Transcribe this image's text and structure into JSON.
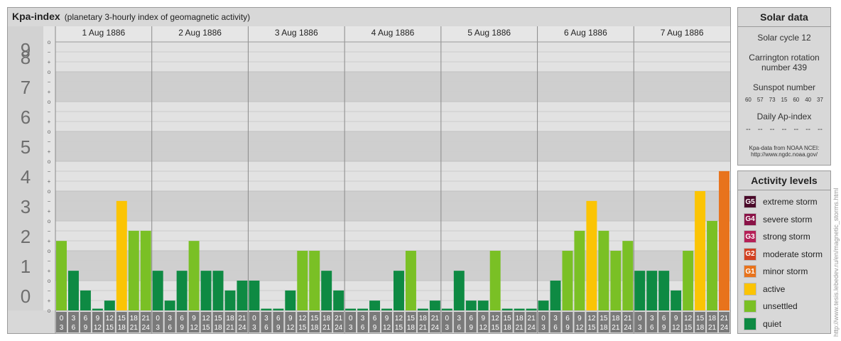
{
  "header": {
    "title": "Kpa-index",
    "subtitle": "(planetary 3-hourly index of geomagnetic activity)"
  },
  "chart_data": {
    "type": "bar",
    "ylim": [
      0,
      9
    ],
    "y_ticks": [
      "0",
      "1",
      "2",
      "3",
      "4",
      "5",
      "6",
      "7",
      "8",
      "9"
    ],
    "sub_ticks": [
      "o",
      "+",
      "−"
    ],
    "days": [
      "1 Aug 1886",
      "2 Aug 1886",
      "3 Aug 1886",
      "4 Aug 1886",
      "5 Aug 1886",
      "6 Aug 1886",
      "7 Aug 1886"
    ],
    "interval_top": [
      "0",
      "3",
      "6",
      "9",
      "12",
      "15",
      "18",
      "21"
    ],
    "interval_bottom": [
      "3",
      "6",
      "9",
      "12",
      "15",
      "18",
      "21",
      "24"
    ],
    "values": [
      [
        2.33,
        1.33,
        0.67,
        0,
        0.33,
        3.67,
        2.67,
        2.67
      ],
      [
        1.33,
        0.33,
        1.33,
        2.33,
        1.33,
        1.33,
        0.67,
        1
      ],
      [
        1,
        0,
        0,
        0.67,
        2,
        2,
        1.33,
        0.67
      ],
      [
        0,
        0,
        0.33,
        0,
        1.33,
        2,
        0,
        0.33
      ],
      [
        0,
        1.33,
        0.33,
        0.33,
        2,
        0,
        0,
        0
      ],
      [
        0.33,
        1,
        2,
        2.67,
        3.67,
        2.67,
        2,
        2.33
      ],
      [
        1.33,
        1.33,
        1.33,
        0.67,
        2,
        4,
        3,
        4.67
      ]
    ],
    "level_colors": {
      "quiet": "#0e8a43",
      "unsettled": "#7ac025",
      "active": "#fbc404",
      "minor_storm": "#e8731c",
      "moderate_storm": "#d24121",
      "strong_storm": "#b52158",
      "severe_storm": "#8a1347",
      "extreme_storm": "#4a0a2a"
    },
    "grid": true
  },
  "solar": {
    "title": "Solar data",
    "cycle": "Solar cycle 12",
    "carrington_line1": "Carrington rotation",
    "carrington_line2": "number 439",
    "sunspot_label": "Sunspot number",
    "sunspot_values": [
      "60",
      "57",
      "73",
      "15",
      "60",
      "40",
      "37"
    ],
    "ap_label": "Daily Ap-index",
    "ap_values": [
      "--",
      "--",
      "--",
      "--",
      "--",
      "--",
      "--"
    ],
    "source_line1": "Kpa-data from NOAA NCEI:",
    "source_line2": "http://www.ngdc.noaa.gov/"
  },
  "levels": {
    "title": "Activity levels",
    "items": [
      {
        "badge": "G5",
        "label": "extreme storm",
        "color": "#4a0a2a"
      },
      {
        "badge": "G4",
        "label": "severe storm",
        "color": "#8a1347"
      },
      {
        "badge": "G3",
        "label": "strong storm",
        "color": "#b52158"
      },
      {
        "badge": "G2",
        "label": "moderate storm",
        "color": "#d24121"
      },
      {
        "badge": "G1",
        "label": "minor storm",
        "color": "#e8731c"
      },
      {
        "badge": "",
        "label": "active",
        "color": "#fbc404"
      },
      {
        "badge": "",
        "label": "unsettled",
        "color": "#7ac025"
      },
      {
        "badge": "",
        "label": "quiet",
        "color": "#0e8a43"
      }
    ]
  },
  "credit": "http://www.tesis.lebedev.ru/en/magnetic_storms.html"
}
